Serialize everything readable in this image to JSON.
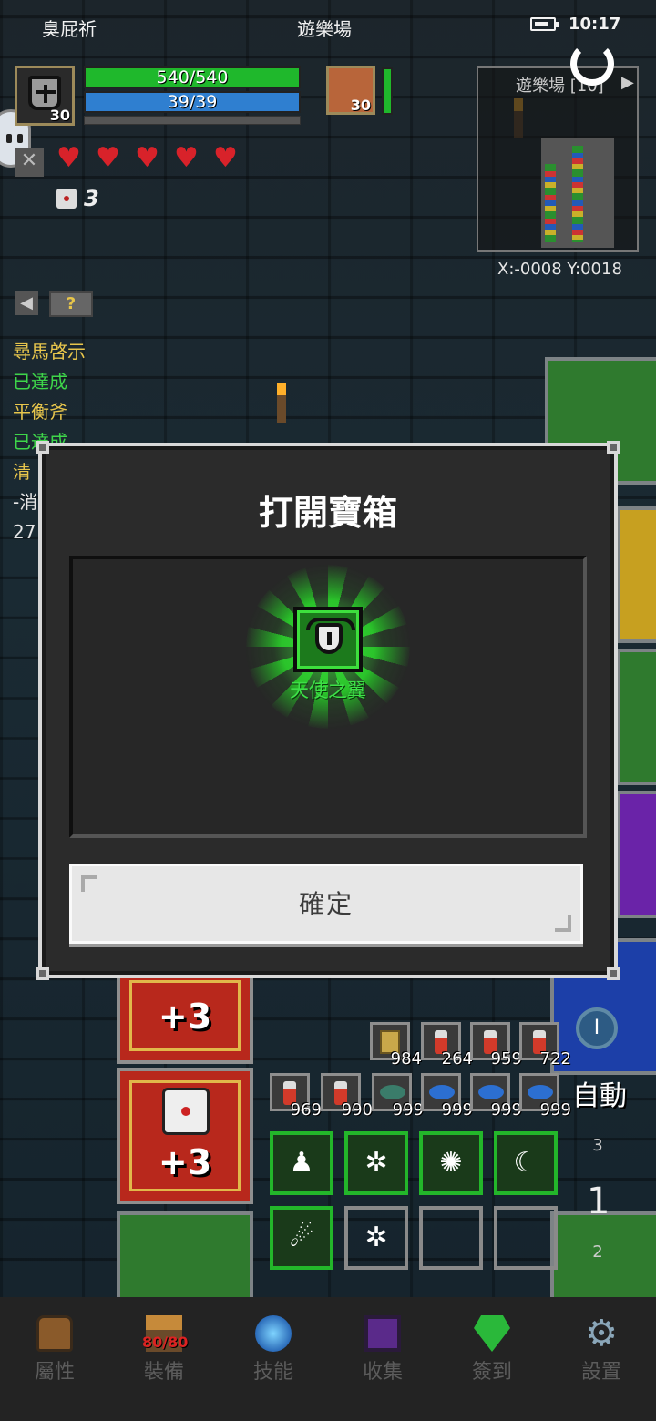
{
  "status_bar": {
    "left_text": "臭屁祈",
    "center_text": "遊樂場",
    "time": "10:17"
  },
  "player": {
    "level": "30",
    "hp": "540/540",
    "mp": "39/39",
    "pet_level": "30",
    "hearts": 5,
    "dice_count": "3"
  },
  "minimap": {
    "title": "遊樂場 [10]",
    "coords": "X:-0008  Y:0018"
  },
  "quests": [
    {
      "text": "尋馬啓示",
      "color": "yellow"
    },
    {
      "text": "已達成",
      "color": "green"
    },
    {
      "text": "平衡斧",
      "color": "yellow"
    },
    {
      "text": "已達成",
      "color": "green"
    },
    {
      "text": "清",
      "color": "yellow"
    },
    {
      "text": "-消",
      "color": "white"
    },
    {
      "text": "27",
      "color": "white"
    }
  ],
  "board": {
    "red_tile_1_plus": "+3",
    "red_tile_2_plus": "+3"
  },
  "inventory": {
    "row1": [
      {
        "icon": "scroll-icon",
        "count": "984"
      },
      {
        "icon": "potion-icon",
        "count": "264"
      },
      {
        "icon": "potion-icon",
        "count": "959"
      },
      {
        "icon": "potion-icon",
        "count": "722"
      }
    ],
    "row2": [
      {
        "icon": "potion-icon",
        "count": "969"
      },
      {
        "icon": "potion-icon",
        "count": "990"
      },
      {
        "icon": "fish-icon",
        "count": "999"
      },
      {
        "icon": "fish-icon",
        "count": "999"
      },
      {
        "icon": "fish-icon",
        "count": "999"
      },
      {
        "icon": "fish-icon",
        "count": "999"
      }
    ]
  },
  "controls": {
    "auto_label": "自動",
    "up_count": "3",
    "floor": "1",
    "down_count": "2"
  },
  "modal": {
    "title": "打開寶箱",
    "reward_name": "天使之翼",
    "confirm_label": "確定"
  },
  "nav": [
    {
      "label": "屬性",
      "icon": "helmet-icon"
    },
    {
      "label": "裝備",
      "icon": "anvil-icon",
      "badge": "80/80"
    },
    {
      "label": "技能",
      "icon": "orb-icon"
    },
    {
      "label": "收集",
      "icon": "book-icon"
    },
    {
      "label": "簽到",
      "icon": "gem-icon"
    },
    {
      "label": "設置",
      "icon": "gear-icon"
    }
  ],
  "colors": {
    "hp": "#1fb82c",
    "mp": "#2f7fd0",
    "quest_yellow": "#e8c64c",
    "quest_green": "#3ed64a",
    "reward_green": "#3ee048",
    "skill_border": "#23b62a"
  }
}
